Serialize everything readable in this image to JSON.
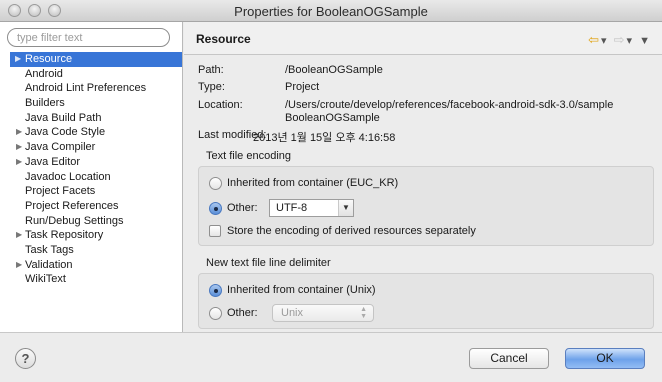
{
  "window": {
    "title": "Properties for BooleanOGSample"
  },
  "sidebar": {
    "filter_placeholder": "type filter text",
    "items": [
      {
        "label": "Resource",
        "expandable": true,
        "selected": true
      },
      {
        "label": "Android",
        "expandable": false
      },
      {
        "label": "Android Lint Preferences",
        "expandable": false
      },
      {
        "label": "Builders",
        "expandable": false
      },
      {
        "label": "Java Build Path",
        "expandable": false
      },
      {
        "label": "Java Code Style",
        "expandable": true
      },
      {
        "label": "Java Compiler",
        "expandable": true
      },
      {
        "label": "Java Editor",
        "expandable": true
      },
      {
        "label": "Javadoc Location",
        "expandable": false
      },
      {
        "label": "Project Facets",
        "expandable": false
      },
      {
        "label": "Project References",
        "expandable": false
      },
      {
        "label": "Run/Debug Settings",
        "expandable": false
      },
      {
        "label": "Task Repository",
        "expandable": true
      },
      {
        "label": "Task Tags",
        "expandable": false
      },
      {
        "label": "Validation",
        "expandable": true
      },
      {
        "label": "WikiText",
        "expandable": false
      }
    ]
  },
  "page": {
    "title": "Resource",
    "icons": {
      "back": "back-arrow-icon",
      "forward": "forward-arrow-icon",
      "menu": "view-menu-icon"
    },
    "properties": {
      "path_label": "Path:",
      "path_value": "/BooleanOGSample",
      "type_label": "Type:",
      "type_value": "Project",
      "location_label": "Location:",
      "location_value_line1": "/Users/croute/develop/references/facebook-android-sdk-3.0/sample",
      "location_value_line2": "BooleanOGSample",
      "modified_label": "Last modified:",
      "modified_value": "2013년 1월 15일 오후 4:16:58"
    },
    "encoding": {
      "group_title": "Text file encoding",
      "inherited_label": "Inherited from container (EUC_KR)",
      "other_label": "Other:",
      "other_value": "UTF-8",
      "store_label": "Store the encoding of derived resources separately",
      "selected": "other"
    },
    "delimiter": {
      "group_title": "New text file line delimiter",
      "inherited_label": "Inherited from container (Unix)",
      "other_label": "Other:",
      "other_value": "Unix",
      "selected": "inherited"
    }
  },
  "footer": {
    "help_symbol": "?",
    "cancel_label": "Cancel",
    "ok_label": "OK"
  }
}
